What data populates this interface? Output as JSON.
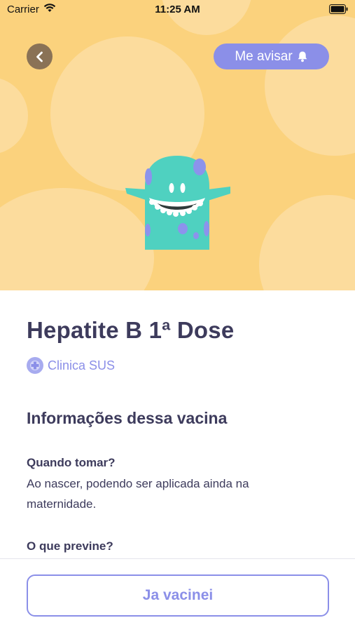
{
  "status_bar": {
    "carrier": "Carrier",
    "time": "11:25 AM",
    "wifi_icon": "wifi-icon",
    "battery_icon": "battery-icon"
  },
  "header": {
    "back_icon": "chevron-left-icon",
    "notify_label": "Me avisar",
    "notify_icon": "bell-icon"
  },
  "vaccine": {
    "title": "Hepatite B 1ª Dose",
    "clinic_icon": "clinic-icon",
    "clinic": "Clinica SUS"
  },
  "info": {
    "section_title": "Informações dessa vacina",
    "items": [
      {
        "label": "Quando tomar?",
        "answer": "Ao nascer, podendo ser aplicada ainda na maternidade."
      },
      {
        "label": "O que previne?",
        "answer": ""
      }
    ]
  },
  "footer": {
    "button_label": "Ja vacinei"
  },
  "colors": {
    "hero_bg": "#fbd27d",
    "accent": "#8b8fe8",
    "text": "#3d3b5c",
    "mascot": "#4fd1c0"
  }
}
